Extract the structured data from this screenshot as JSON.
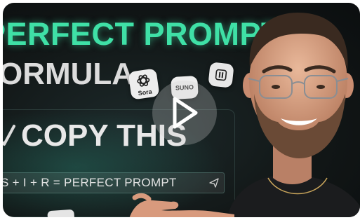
{
  "video": {
    "headline_line1": "PERFECT PROMPT",
    "headline_line2": "ORMULA",
    "callout": "COPY THIS",
    "prompt_formula": "S + I + R = PERFECT PROMPT",
    "app_tiles": {
      "sora_label": "Sora",
      "suno_label": "SUNO"
    }
  },
  "colors": {
    "accent_green": "#3fe0a6",
    "background": "#121717"
  },
  "icons": [
    "play-icon",
    "send-icon",
    "openai-logo-icon",
    "pause-icon",
    "checkmark-icon"
  ]
}
